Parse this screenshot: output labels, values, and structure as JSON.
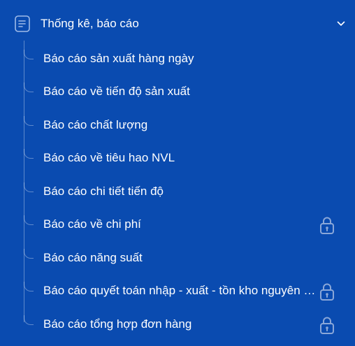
{
  "group": {
    "title": "Thống kê, báo cáo",
    "icon": "document-icon",
    "expanded": true,
    "toggle_icon": "chevron-down-icon"
  },
  "colors": {
    "background": "#0a4bb0",
    "text": "#ffffff",
    "lock": "#8aa7d8"
  },
  "items": [
    {
      "label": "Báo cáo sản xuất hàng ngày",
      "locked": false
    },
    {
      "label": "Báo cáo về tiến độ sản xuất",
      "locked": false
    },
    {
      "label": "Báo cáo chất lượng",
      "locked": false
    },
    {
      "label": "Báo cáo về tiêu hao NVL",
      "locked": false
    },
    {
      "label": "Báo cáo chi tiết tiến độ",
      "locked": false
    },
    {
      "label": "Báo cáo về chi phí",
      "locked": true
    },
    {
      "label": "Báo cáo năng suất",
      "locked": false
    },
    {
      "label": "Báo cáo quyết toán nhập - xuất - tồn kho nguyên vật liệu",
      "locked": true
    },
    {
      "label": "Báo cáo tổng hợp đơn hàng",
      "locked": true
    }
  ]
}
